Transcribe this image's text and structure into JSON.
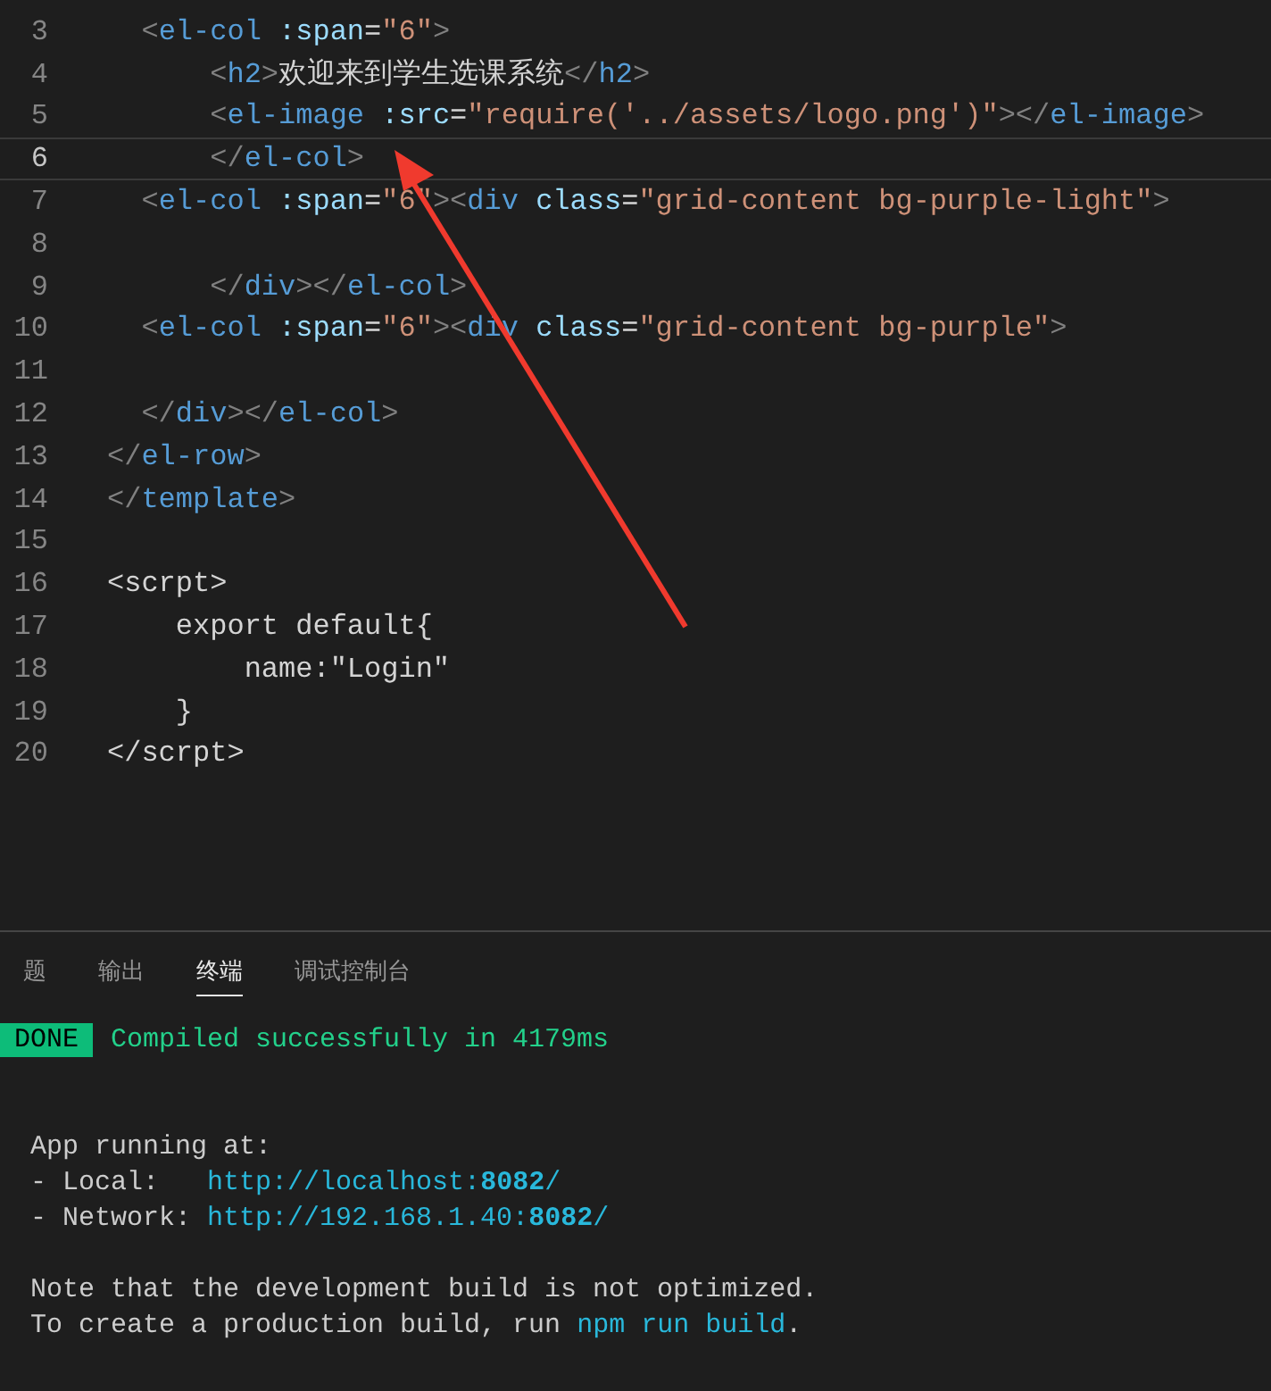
{
  "editor": {
    "lines": [
      {
        "number": "3",
        "current": false,
        "tokens": [
          {
            "kind": "p",
            "text": "  <"
          },
          {
            "kind": "tag",
            "text": "el-col"
          },
          {
            "kind": "attr",
            "text": " :span"
          },
          {
            "kind": "txt",
            "text": "="
          },
          {
            "kind": "str",
            "text": "\"6\""
          },
          {
            "kind": "p",
            "text": ">"
          }
        ]
      },
      {
        "number": "4",
        "current": false,
        "tokens": [
          {
            "kind": "p",
            "text": "      <"
          },
          {
            "kind": "tag",
            "text": "h2"
          },
          {
            "kind": "p",
            "text": ">"
          },
          {
            "kind": "txt",
            "text": "欢迎来到学生选课系统"
          },
          {
            "kind": "p",
            "text": "</"
          },
          {
            "kind": "tag",
            "text": "h2"
          },
          {
            "kind": "p",
            "text": ">"
          }
        ]
      },
      {
        "number": "5",
        "current": false,
        "tokens": [
          {
            "kind": "p",
            "text": "      <"
          },
          {
            "kind": "tag",
            "text": "el-image"
          },
          {
            "kind": "attr",
            "text": " :src"
          },
          {
            "kind": "txt",
            "text": "="
          },
          {
            "kind": "str",
            "text": "\"require('../assets/logo.png')\""
          },
          {
            "kind": "p",
            "text": "></"
          },
          {
            "kind": "tag",
            "text": "el-image"
          },
          {
            "kind": "p",
            "text": ">"
          }
        ]
      },
      {
        "number": "6",
        "current": true,
        "tokens": [
          {
            "kind": "p",
            "text": "      </"
          },
          {
            "kind": "tag",
            "text": "el-col"
          },
          {
            "kind": "p",
            "text": ">"
          }
        ]
      },
      {
        "number": "7",
        "current": false,
        "tokens": [
          {
            "kind": "p",
            "text": "  <"
          },
          {
            "kind": "tag",
            "text": "el-col"
          },
          {
            "kind": "attr",
            "text": " :span"
          },
          {
            "kind": "txt",
            "text": "="
          },
          {
            "kind": "str",
            "text": "\"6\""
          },
          {
            "kind": "p",
            "text": "><"
          },
          {
            "kind": "tag",
            "text": "div"
          },
          {
            "kind": "attr",
            "text": " class"
          },
          {
            "kind": "txt",
            "text": "="
          },
          {
            "kind": "str",
            "text": "\"grid-content bg-purple-light\""
          },
          {
            "kind": "p",
            "text": ">"
          }
        ]
      },
      {
        "number": "8",
        "current": false
      },
      {
        "number": "9",
        "current": false,
        "tokens": [
          {
            "kind": "p",
            "text": "      </"
          },
          {
            "kind": "tag",
            "text": "div"
          },
          {
            "kind": "p",
            "text": "></"
          },
          {
            "kind": "tag",
            "text": "el-col"
          },
          {
            "kind": "p",
            "text": ">"
          }
        ]
      },
      {
        "number": "10",
        "current": false,
        "tokens": [
          {
            "kind": "p",
            "text": "  <"
          },
          {
            "kind": "tag",
            "text": "el-col"
          },
          {
            "kind": "attr",
            "text": " :span"
          },
          {
            "kind": "txt",
            "text": "="
          },
          {
            "kind": "str",
            "text": "\"6\""
          },
          {
            "kind": "p",
            "text": "><"
          },
          {
            "kind": "tag",
            "text": "div"
          },
          {
            "kind": "attr",
            "text": " class"
          },
          {
            "kind": "txt",
            "text": "="
          },
          {
            "kind": "str",
            "text": "\"grid-content bg-purple\""
          },
          {
            "kind": "p",
            "text": ">"
          }
        ]
      },
      {
        "number": "11",
        "current": false
      },
      {
        "number": "12",
        "current": false,
        "tokens": [
          {
            "kind": "p",
            "text": "  </"
          },
          {
            "kind": "tag",
            "text": "div"
          },
          {
            "kind": "p",
            "text": "></"
          },
          {
            "kind": "tag",
            "text": "el-col"
          },
          {
            "kind": "p",
            "text": ">"
          }
        ]
      },
      {
        "number": "13",
        "current": false,
        "tokens": [
          {
            "kind": "p",
            "text": "</"
          },
          {
            "kind": "tag",
            "text": "el-row"
          },
          {
            "kind": "p",
            "text": ">"
          }
        ]
      },
      {
        "number": "14",
        "current": false,
        "tokens": [
          {
            "kind": "p",
            "text": "</"
          },
          {
            "kind": "tag",
            "text": "template"
          },
          {
            "kind": "p",
            "text": ">"
          }
        ]
      },
      {
        "number": "15",
        "current": false
      },
      {
        "number": "16",
        "current": false,
        "tokens": [
          {
            "kind": "txt",
            "text": "<scrpt>"
          }
        ]
      },
      {
        "number": "17",
        "current": false,
        "tokens": [
          {
            "kind": "txt",
            "text": "    export default{"
          }
        ]
      },
      {
        "number": "18",
        "current": false,
        "tokens": [
          {
            "kind": "txt",
            "text": "        name:\"Login\""
          }
        ]
      },
      {
        "number": "19",
        "current": false,
        "tokens": [
          {
            "kind": "txt",
            "text": "    }"
          }
        ]
      },
      {
        "number": "20",
        "current": false,
        "tokens": [
          {
            "kind": "txt",
            "text": "</scrpt>"
          }
        ]
      }
    ]
  },
  "panel": {
    "tabs": [
      {
        "label": "题",
        "selected": false
      },
      {
        "label": "输出",
        "selected": false
      },
      {
        "label": "终端",
        "selected": true
      },
      {
        "label": "调试控制台",
        "selected": false
      }
    ],
    "terminal": {
      "groups": [
        {
          "lines": [
            [
              {
                "kind": "badge",
                "text": "DONE"
              },
              {
                "kind": "success",
                "text": "Compiled successfully in 4179ms"
              }
            ]
          ]
        },
        {
          "lines": [
            [
              {
                "kind": "plain",
                "text": "App running at:"
              }
            ],
            [
              {
                "kind": "plain",
                "text": "- Local:   "
              },
              {
                "kind": "link",
                "text": "http://localhost:"
              },
              {
                "kind": "link-bold",
                "text": "8082"
              },
              {
                "kind": "link",
                "text": "/"
              }
            ],
            [
              {
                "kind": "plain",
                "text": "- Network: "
              },
              {
                "kind": "link",
                "text": "http://192.168.1.40:"
              },
              {
                "kind": "link-bold",
                "text": "8082"
              },
              {
                "kind": "link",
                "text": "/"
              }
            ]
          ]
        },
        {
          "lines": [
            [
              {
                "kind": "plain",
                "text": "Note that the development build is not optimized."
              }
            ],
            [
              {
                "kind": "plain",
                "text": "To create a production build, run "
              },
              {
                "kind": "link",
                "text": "npm run build"
              },
              {
                "kind": "plain",
                "text": "."
              }
            ]
          ]
        }
      ]
    }
  }
}
